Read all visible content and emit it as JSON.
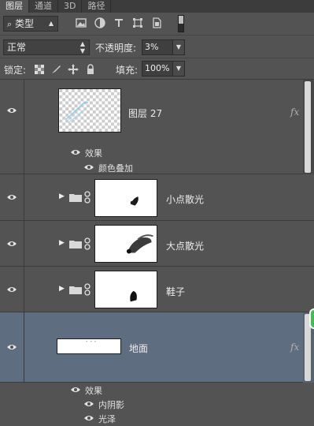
{
  "tabs": [
    {
      "label": "图层",
      "active": true
    },
    {
      "label": "通道",
      "active": false
    },
    {
      "label": "3D",
      "active": false
    },
    {
      "label": "路径",
      "active": false
    }
  ],
  "filter": {
    "label": "类型",
    "search_icon": "search-icon"
  },
  "filter_icons": [
    "image-filter-icon",
    "adjustment-filter-icon",
    "type-filter-icon",
    "shape-filter-icon",
    "smart-object-filter-icon"
  ],
  "blend": {
    "mode": "正常",
    "opacity_label": "不透明度:",
    "opacity_value": "3%"
  },
  "lock": {
    "label": "锁定:",
    "icons": [
      "lock-transparency-icon",
      "lock-pixels-icon",
      "lock-position-icon",
      "lock-all-icon"
    ],
    "fill_label": "填充:",
    "fill_value": "100%"
  },
  "layers": [
    {
      "name": "图层 27",
      "fx": "fx",
      "effects_label": "效果",
      "effects": [
        "颜色叠加"
      ]
    },
    {
      "name": "小点散光"
    },
    {
      "name": "大点散光"
    },
    {
      "name": "鞋子"
    },
    {
      "name": "地面",
      "fx": "fx",
      "effects_label": "效果",
      "effects": [
        "内阴影",
        "光泽"
      ]
    }
  ],
  "colors": {
    "selected_row": "#5f6d80",
    "panel": "#535353",
    "accent_green": "#3fbf4f"
  }
}
